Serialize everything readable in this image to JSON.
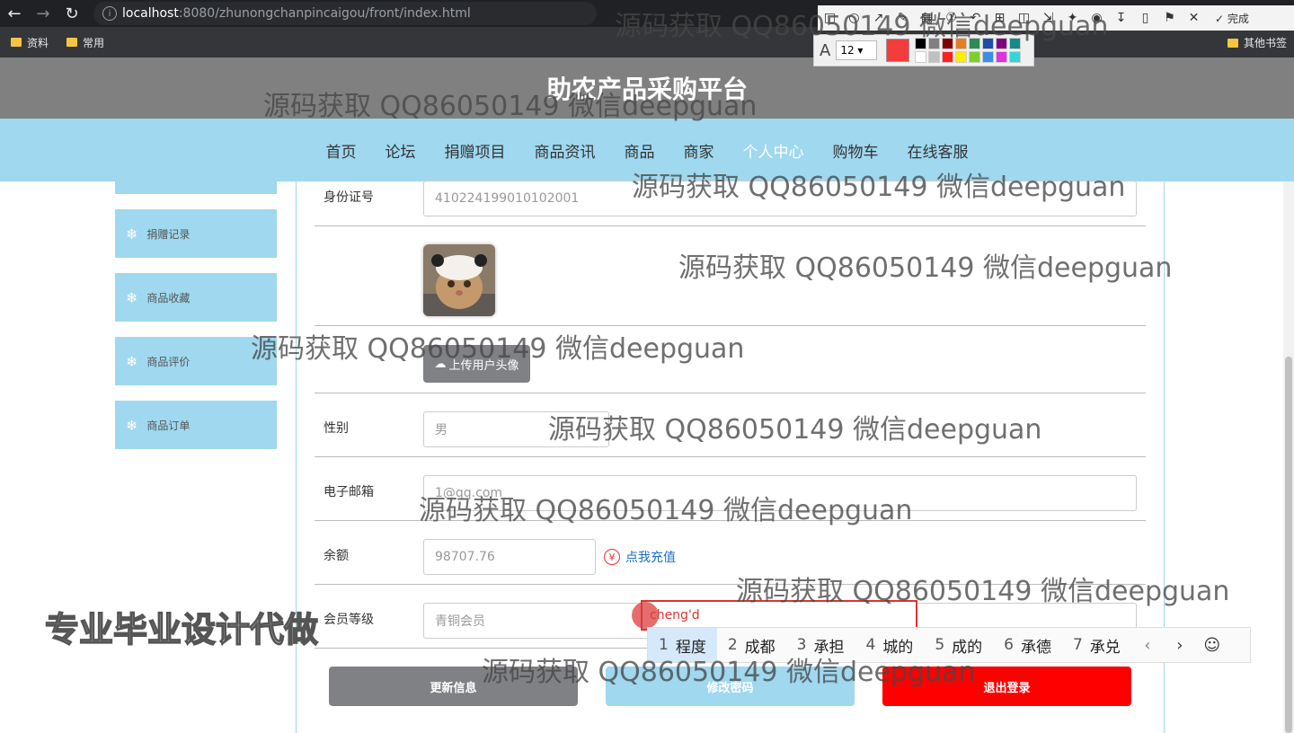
{
  "browser": {
    "url_host": "localhost",
    "url_path": ":8080/zhunongchanpincaigou/front/index.html",
    "bookmarks": [
      "资料",
      "常用"
    ],
    "bookmarks_other": "其他书签"
  },
  "screenshot_tool": {
    "done_label": "完成",
    "font_size": "12",
    "palette": [
      "#000000",
      "#808080",
      "#800000",
      "#e67e22",
      "#2e8b57",
      "#1e4fa8",
      "#800080",
      "#168a8a",
      "#ffffff",
      "#c0c0c0",
      "#ff2020",
      "#ffee00",
      "#7ccf2a",
      "#3a8ee6",
      "#e033e0",
      "#33d6d6"
    ]
  },
  "site": {
    "title": "助农产品采购平台",
    "nav": [
      "首页",
      "论坛",
      "捐赠项目",
      "商品资讯",
      "商品",
      "商家",
      "个人中心",
      "购物车",
      "在线客服"
    ],
    "nav_active_index": 6
  },
  "sidebar": {
    "items": [
      "捐赠记录",
      "商品收藏",
      "商品评价",
      "商品订单"
    ]
  },
  "form": {
    "id_label": "身份证号",
    "id_value": "410224199010102001",
    "upload_label": "上传用户头像",
    "gender_label": "性别",
    "gender_value": "男",
    "email_label": "电子邮箱",
    "email_value": "1@qq.com",
    "balance_label": "余额",
    "balance_value": "98707.76",
    "recharge_label": "点我充值",
    "level_label": "会员等级",
    "level_value": "青铜会员",
    "update_button": "更新信息",
    "password_button": "修改密码",
    "logout_button": "退出登录"
  },
  "ime": {
    "composition": "cheng'd",
    "candidates": [
      {
        "num": "1",
        "text": "程度"
      },
      {
        "num": "2",
        "text": "成都"
      },
      {
        "num": "3",
        "text": "承担"
      },
      {
        "num": "4",
        "text": "城的"
      },
      {
        "num": "5",
        "text": "成的"
      },
      {
        "num": "6",
        "text": "承德"
      },
      {
        "num": "7",
        "text": "承兑"
      }
    ]
  },
  "watermarks": {
    "text": "源码获取 QQ86050149 微信deepguan",
    "promo": "专业毕业设计代做"
  }
}
